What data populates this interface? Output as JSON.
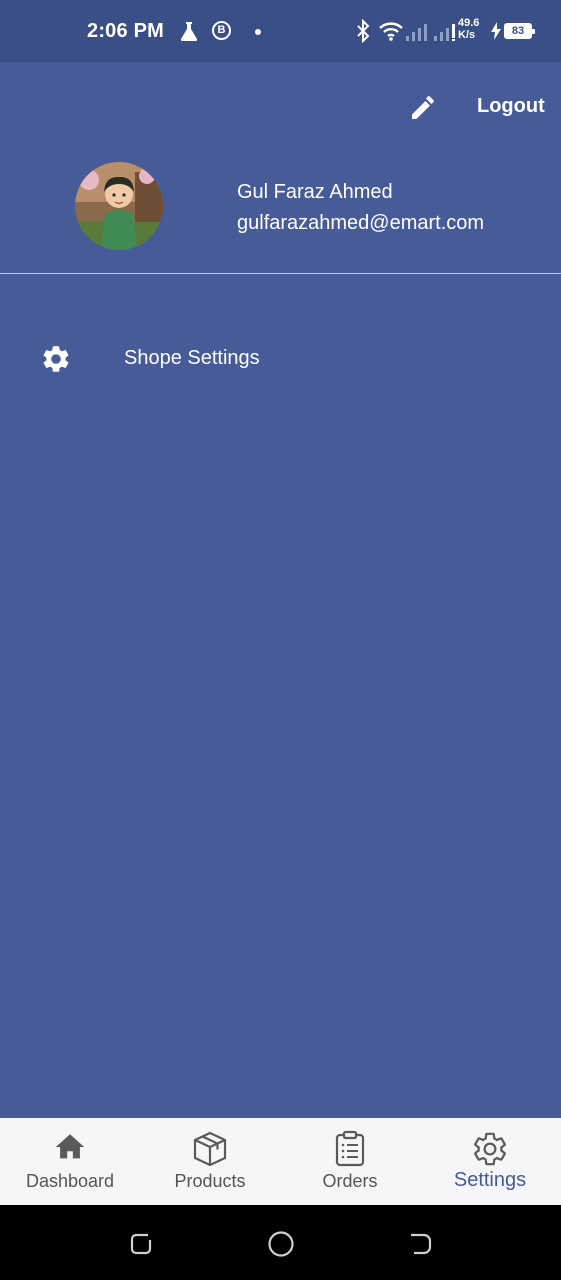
{
  "status_bar": {
    "time": "2:06 PM",
    "b_badge": "B",
    "speed_value": "49.6",
    "speed_unit": "K/s",
    "battery": "83",
    "icons": [
      "flask-icon",
      "b-badge-icon",
      "dot-icon",
      "bluetooth-icon",
      "wifi-icon",
      "signal-icon",
      "signal-icon",
      "charging-icon",
      "battery-icon"
    ]
  },
  "header": {
    "edit_icon": "pencil-icon",
    "logout_label": "Logout"
  },
  "profile": {
    "name": "Gul Faraz Ahmed",
    "email": "gulfarazahmed@emart.com"
  },
  "menu": {
    "items": [
      {
        "label": "Shope Settings",
        "icon": "gear-icon"
      }
    ]
  },
  "bottom_nav": {
    "tabs": [
      {
        "label": "Dashboard",
        "icon": "home-icon",
        "active": false
      },
      {
        "label": "Products",
        "icon": "box-icon",
        "active": false
      },
      {
        "label": "Orders",
        "icon": "clipboard-icon",
        "active": false
      },
      {
        "label": "Settings",
        "icon": "gear-icon",
        "active": true
      }
    ]
  },
  "colors": {
    "background": "#465b97",
    "status_bar": "#3a4f86",
    "bottom_nav": "#f6f6f8",
    "active_tab": "#465b97",
    "inactive_tab": "#555555"
  }
}
